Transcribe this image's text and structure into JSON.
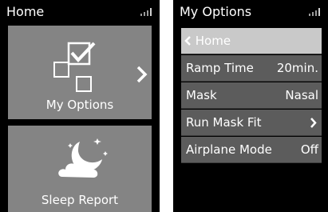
{
  "left_screen": {
    "title": "Home",
    "tiles": [
      {
        "label": "My Options",
        "icon": "checklist-icon",
        "has_arrow": true
      },
      {
        "label": "Sleep Report",
        "icon": "moon-cloud-icon"
      }
    ]
  },
  "right_screen": {
    "title": "My Options",
    "home_label": "Home",
    "items": [
      {
        "label": "Ramp Time",
        "value": "20min."
      },
      {
        "label": "Mask",
        "value": "Nasal"
      },
      {
        "label": "Run Mask Fit",
        "value": ""
      },
      {
        "label": "Airplane Mode",
        "value": "Off"
      }
    ]
  },
  "colors": {
    "background": "#000000",
    "tile": "#848484",
    "row": "#5c5c5c",
    "row_selected": "#c9c9c9",
    "text": "#ffffff"
  }
}
